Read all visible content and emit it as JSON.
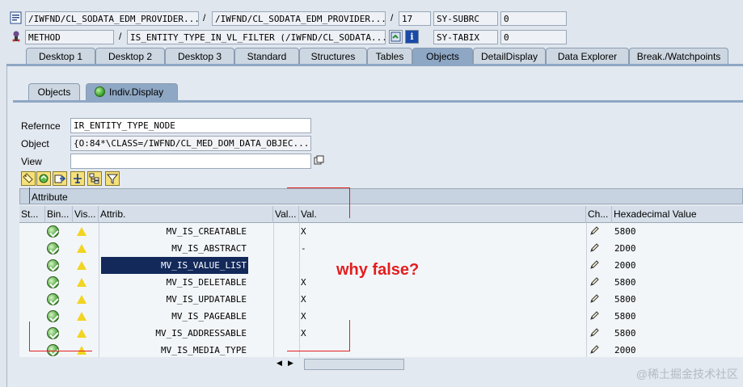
{
  "header": {
    "row1": {
      "field1": "/IWFND/CL_SODATA_EDM_PROVIDER...",
      "field2": "/IWFND/CL_SODATA_EDM_PROVIDER...",
      "line": "17",
      "sysvar": "SY-SUBRC",
      "sysval": "0"
    },
    "row2": {
      "field1": "METHOD",
      "field2": "IS_ENTITY_TYPE_IN_VL_FILTER (/IWFND/CL_SODATA...",
      "sysvar": "SY-TABIX",
      "sysval": "0"
    }
  },
  "tabs": [
    "Desktop 1",
    "Desktop 2",
    "Desktop 3",
    "Standard",
    "Structures",
    "Tables",
    "Objects",
    "DetailDisplay",
    "Data Explorer",
    "Break./Watchpoints"
  ],
  "active_tab": "Objects",
  "inner_tabs": [
    "Objects",
    "Indiv.Display"
  ],
  "form": {
    "reference_label": "Refernce",
    "reference_value": "IR_ENTITY_TYPE_NODE",
    "object_label": "Object",
    "object_value": "{O:84*\\CLASS=/IWFND/CL_MED_DOM_DATA_OBJEC...",
    "view_label": "View",
    "view_value": ""
  },
  "table": {
    "title": "Attribute",
    "columns": [
      "St...",
      "Bin...",
      "Vis...",
      "Attrib.",
      "Val...",
      "Val.",
      "Ch...",
      "Hexadecimal Value"
    ],
    "rows": [
      {
        "attrib": "MV_IS_CREATABLE",
        "val": "X",
        "hex": "5800"
      },
      {
        "attrib": "MV_IS_ABSTRACT",
        "val": "-",
        "hex": "2D00"
      },
      {
        "attrib": "MV_IS_VALUE_LIST",
        "val": "",
        "hex": "2000",
        "selected": true
      },
      {
        "attrib": "MV_IS_DELETABLE",
        "val": "X",
        "hex": "5800"
      },
      {
        "attrib": "MV_IS_UPDATABLE",
        "val": "X",
        "hex": "5800"
      },
      {
        "attrib": "MV_IS_PAGEABLE",
        "val": "X",
        "hex": "5800"
      },
      {
        "attrib": "MV_IS_ADDRESSABLE",
        "val": "X",
        "hex": "5800"
      },
      {
        "attrib": "MV_IS_MEDIA_TYPE",
        "val": "",
        "hex": "2000"
      }
    ]
  },
  "annotation": "why false?",
  "watermark": "@稀土掘金技术社区",
  "colors": {
    "annotation_red": "#e31e1e",
    "selection": "#12295a",
    "tab_active": "#8ea7c4"
  }
}
